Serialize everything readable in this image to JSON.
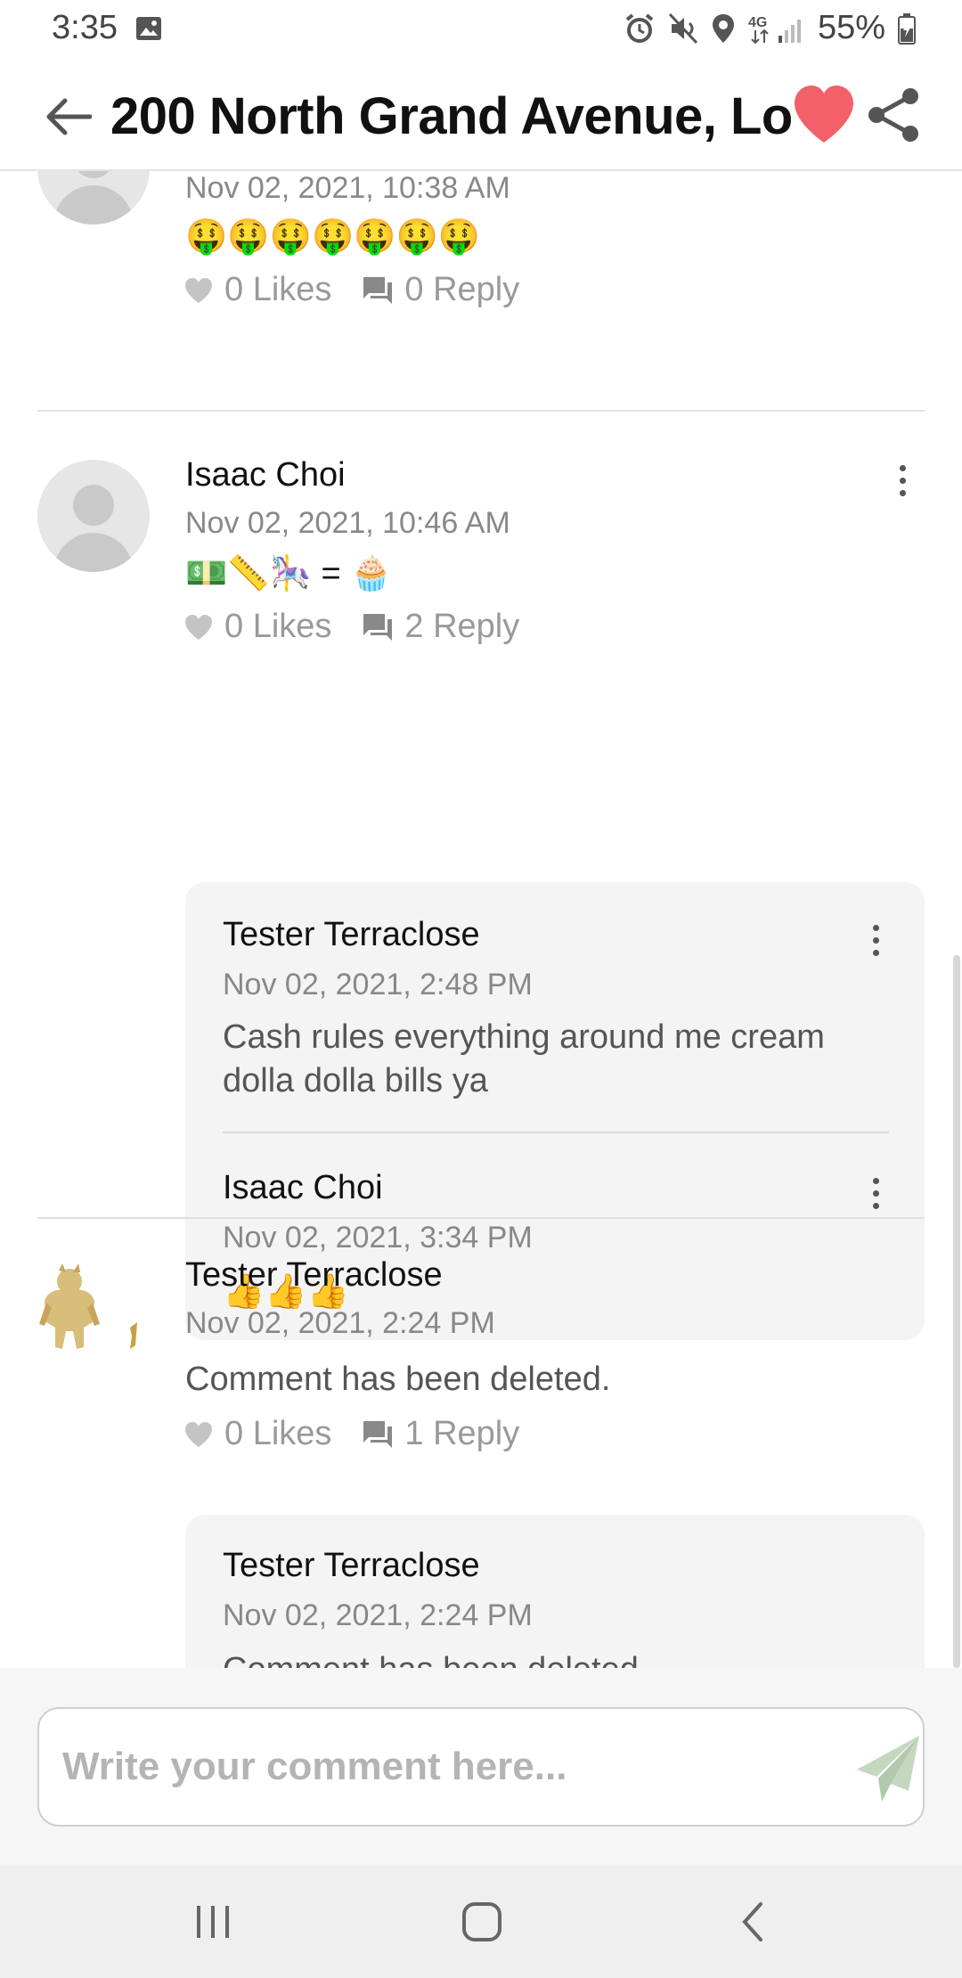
{
  "status_bar": {
    "time": "3:35",
    "battery": "55%",
    "network": "4G"
  },
  "header": {
    "title": "200 North Grand Avenue, Lo",
    "favorite_color": "#f2606a"
  },
  "comments": [
    {
      "date": "Nov 02, 2021,  10:38 AM",
      "text": "🤑🤑🤑🤑🤑🤑🤑",
      "likes": "0 Likes",
      "replies": "0 Reply"
    },
    {
      "author": "Isaac Choi",
      "date": "Nov 02, 2021,  10:46 AM",
      "text": "💵📏🎠 = 🧁",
      "likes": "0 Likes",
      "replies": "2 Reply",
      "reply_items": [
        {
          "author": "Tester Terraclose",
          "date": "Nov 02, 2021,  2:48 PM",
          "text": "Cash rules everything around me cream dolla dolla bills ya"
        },
        {
          "author": "Isaac Choi",
          "date": "Nov 02, 2021,  3:34 PM",
          "text": "👍👍👍"
        }
      ]
    },
    {
      "author": "Tester Terraclose",
      "date": "Nov 02, 2021,  2:24 PM",
      "text": "Comment has been deleted.",
      "likes": "0 Likes",
      "replies": "1 Reply",
      "reply_items": [
        {
          "author": "Tester Terraclose",
          "date": "Nov 02, 2021,  2:24 PM",
          "text": "Comment has been deleted."
        }
      ]
    }
  ],
  "composer": {
    "placeholder": "Write your comment here...",
    "send_color": "#c5d7bf"
  },
  "icons": [
    "back-arrow-icon",
    "heart-icon",
    "share-icon",
    "kebab-menu-icon",
    "like-heart-icon",
    "reply-chat-icon",
    "send-icon",
    "recents-icon",
    "home-icon",
    "back-icon"
  ]
}
